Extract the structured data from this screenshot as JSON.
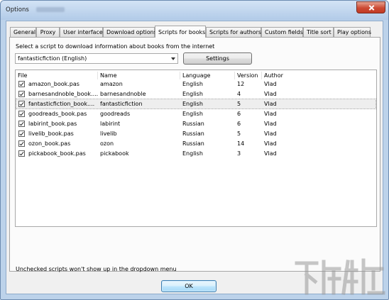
{
  "window": {
    "title": "Options"
  },
  "tabs": [
    {
      "label": "General"
    },
    {
      "label": "Proxy"
    },
    {
      "label": "User interface"
    },
    {
      "label": "Download options"
    },
    {
      "label": "Scripts for books",
      "active": true
    },
    {
      "label": "Scripts for authors"
    },
    {
      "label": "Custom fields"
    },
    {
      "label": "Title sort"
    },
    {
      "label": "Play options"
    }
  ],
  "scripts_panel": {
    "prompt": "Select a script to download information about books from the internet",
    "selected_script": "fantasticfiction (English)",
    "settings_label": "Settings",
    "columns": [
      "File",
      "Name",
      "Language",
      "Version",
      "Author"
    ],
    "rows": [
      {
        "file": "amazon_book.pas",
        "name": "amazon",
        "language": "English",
        "version": "12",
        "author": "Vlad",
        "checked": true
      },
      {
        "file": "barnesandnoble_book....",
        "name": "barnesandnoble",
        "language": "English",
        "version": "4",
        "author": "Vlad",
        "checked": true
      },
      {
        "file": "fantasticfiction_book....",
        "name": "fantasticfiction",
        "language": "English",
        "version": "5",
        "author": "Vlad",
        "checked": true,
        "selected": true
      },
      {
        "file": "goodreads_book.pas",
        "name": "goodreads",
        "language": "English",
        "version": "6",
        "author": "Vlad",
        "checked": true
      },
      {
        "file": "labirint_book.pas",
        "name": "labirint",
        "language": "Russian",
        "version": "6",
        "author": "Vlad",
        "checked": true
      },
      {
        "file": "livelib_book.pas",
        "name": "livelib",
        "language": "Russian",
        "version": "5",
        "author": "Vlad",
        "checked": true
      },
      {
        "file": "ozon_book.pas",
        "name": "ozon",
        "language": "Russian",
        "version": "14",
        "author": "Vlad",
        "checked": true
      },
      {
        "file": "pickabook_book.pas",
        "name": "pickabook",
        "language": "English",
        "version": "3",
        "author": "Vlad",
        "checked": true
      }
    ],
    "footnote": "Unchecked scripts won't show up in the dropdown menu"
  },
  "ok_label": "OK",
  "colors": {
    "selected_row": "#eeeeee",
    "close_button": "#cc4a33",
    "tab_border": "#a6a6a6"
  },
  "icons": [
    "close-icon",
    "dropdown-arrow-icon",
    "checkbox-icon"
  ]
}
